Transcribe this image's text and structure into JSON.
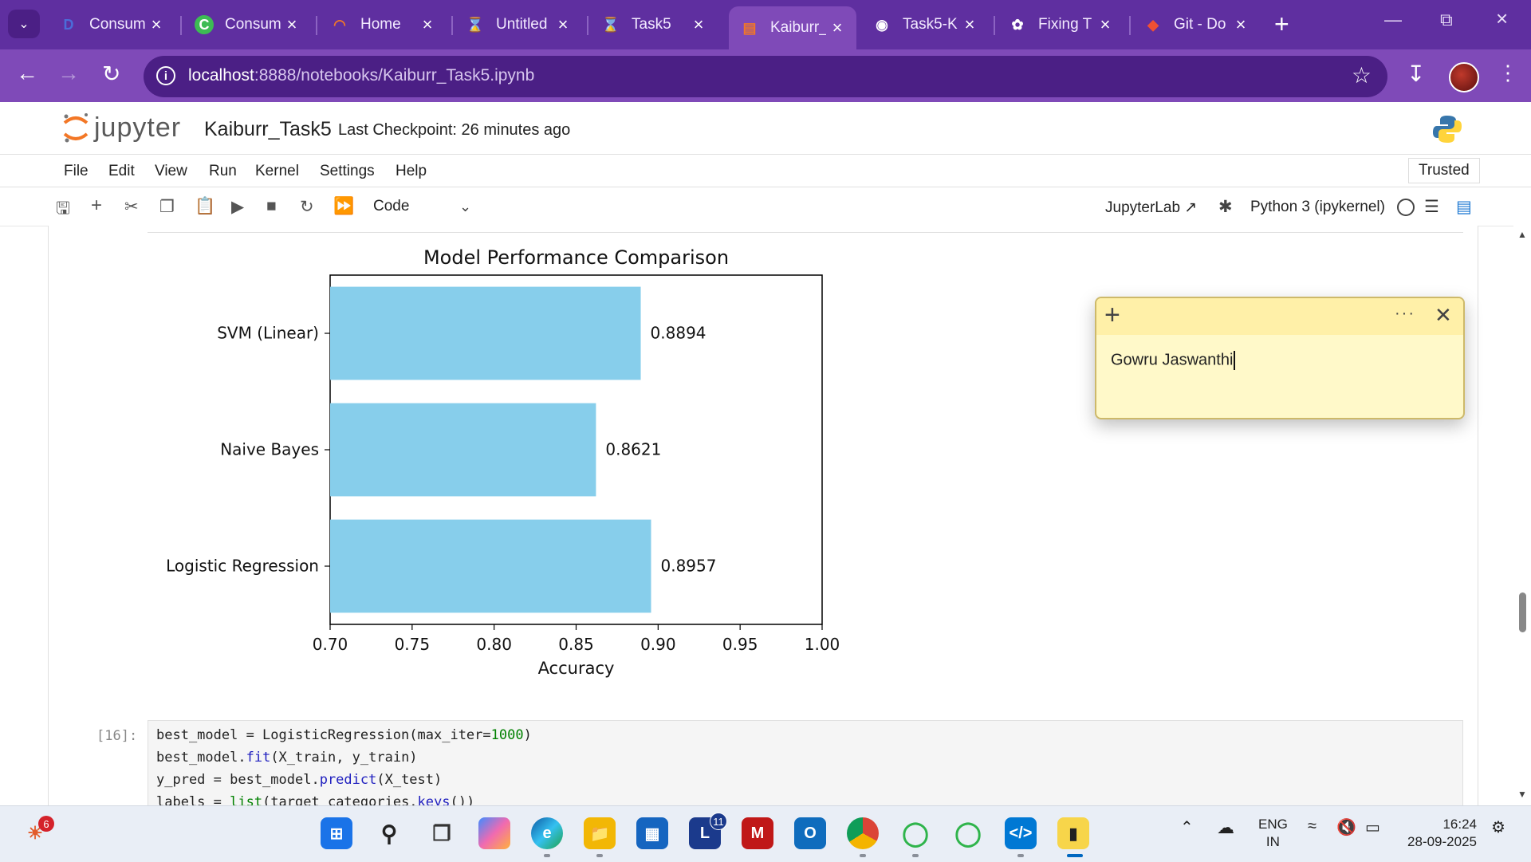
{
  "browser": {
    "tabs": [
      {
        "title": "Consum",
        "icon": "D"
      },
      {
        "title": "Consum",
        "icon": "C"
      },
      {
        "title": "Home",
        "icon": "arc"
      },
      {
        "title": "Untitled",
        "icon": "hourglass"
      },
      {
        "title": "Task5",
        "icon": "hourglass"
      },
      {
        "title": "Kaiburr_",
        "icon": "notebook",
        "active": true
      },
      {
        "title": "Task5-K",
        "icon": "github"
      },
      {
        "title": "Fixing T",
        "icon": "openai"
      },
      {
        "title": "Git - Do",
        "icon": "git"
      }
    ],
    "url_host": "localhost",
    "url_path": ":8888/notebooks/Kaiburr_Task5.ipynb"
  },
  "jupyter": {
    "logo_text": "jupyter",
    "notebook_name": "Kaiburr_Task5",
    "checkpoint": "Last Checkpoint: 26 minutes ago",
    "menu": [
      "File",
      "Edit",
      "View",
      "Run",
      "Kernel",
      "Settings",
      "Help"
    ],
    "trusted": "Trusted",
    "cell_type": "Code",
    "jupyterlab_link": "JupyterLab",
    "kernel": "Python 3 (ipykernel)"
  },
  "chart_data": {
    "type": "bar",
    "orientation": "horizontal",
    "title": "Model Performance Comparison",
    "xlabel": "Accuracy",
    "ylabel": "",
    "categories": [
      "SVM (Linear)",
      "Naive Bayes",
      "Logistic Regression"
    ],
    "values": [
      0.8894,
      0.8621,
      0.8957
    ],
    "data_labels": [
      "0.8894",
      "0.8621",
      "0.8957"
    ],
    "xlim": [
      0.7,
      1.0
    ],
    "xticks": [
      "0.70",
      "0.75",
      "0.80",
      "0.85",
      "0.90",
      "0.95",
      "1.00"
    ],
    "bar_color": "#87ceeb",
    "grid": false
  },
  "code_cell": {
    "prompt": "[16]:",
    "lines": [
      "best_model = LogisticRegression(max_iter=1000)",
      "best_model.fit(X_train, y_train)",
      "y_pred = best_model.predict(X_test)",
      "labels = list(target_categories.keys())"
    ]
  },
  "sticky_note": {
    "text": "Gowru Jaswanthi"
  },
  "taskbar": {
    "weather_badge": "6",
    "word_badge": "11",
    "lang": "ENG",
    "region": "IN",
    "time": "16:24",
    "date": "28-09-2025"
  }
}
